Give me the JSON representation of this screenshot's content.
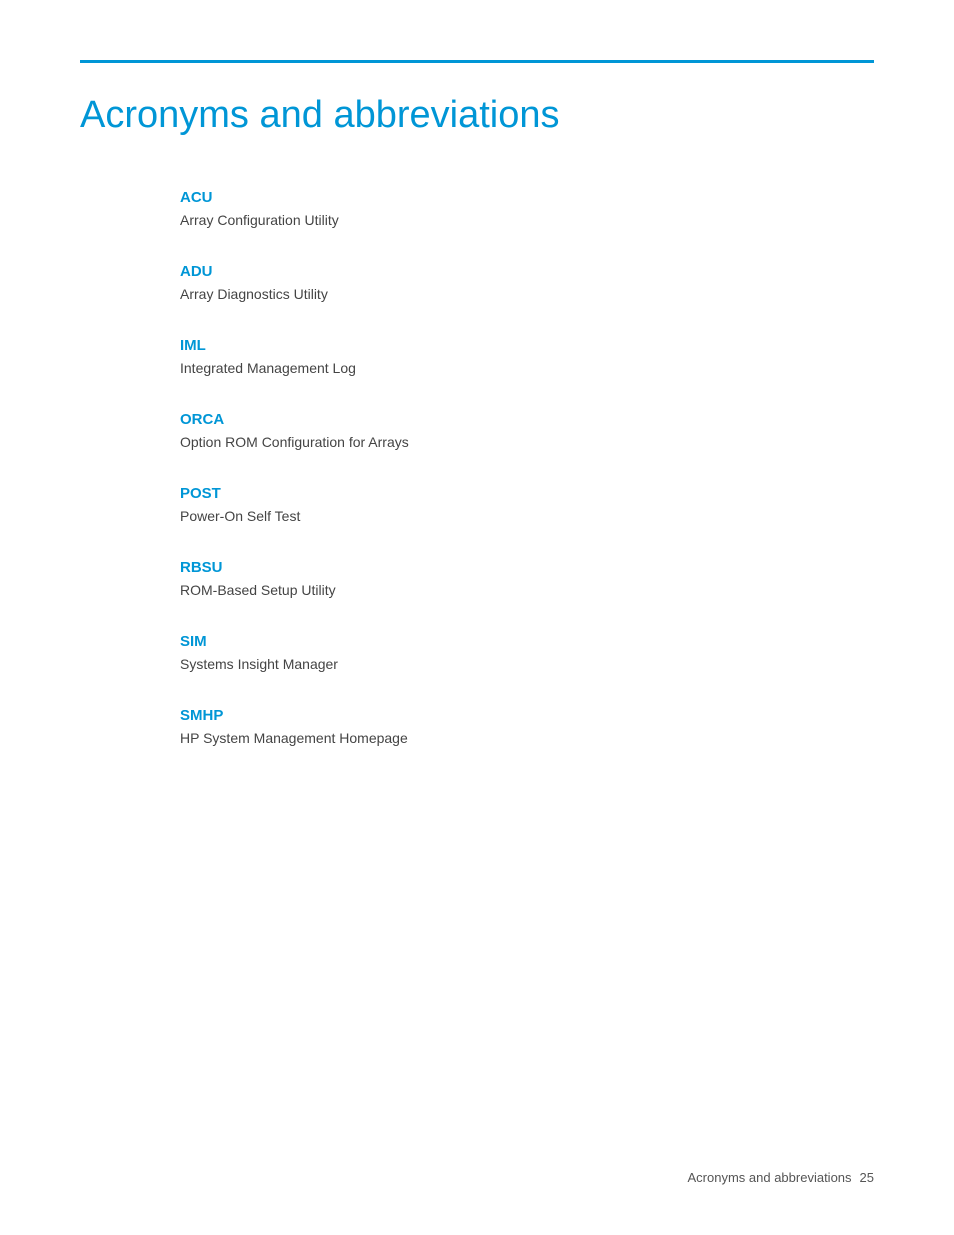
{
  "page": {
    "title": "Acronyms and abbreviations",
    "accent_color": "#0096d6",
    "footer": {
      "label": "Acronyms and abbreviations",
      "page_number": "25"
    }
  },
  "acronyms": [
    {
      "term": "ACU",
      "definition": "Array Configuration Utility"
    },
    {
      "term": "ADU",
      "definition": "Array Diagnostics Utility"
    },
    {
      "term": "IML",
      "definition": "Integrated Management Log"
    },
    {
      "term": "ORCA",
      "definition": "Option ROM Configuration for Arrays"
    },
    {
      "term": "POST",
      "definition": "Power-On Self Test"
    },
    {
      "term": "RBSU",
      "definition": "ROM-Based Setup Utility"
    },
    {
      "term": "SIM",
      "definition": "Systems Insight Manager"
    },
    {
      "term": "SMHP",
      "definition": "HP System Management Homepage"
    }
  ]
}
